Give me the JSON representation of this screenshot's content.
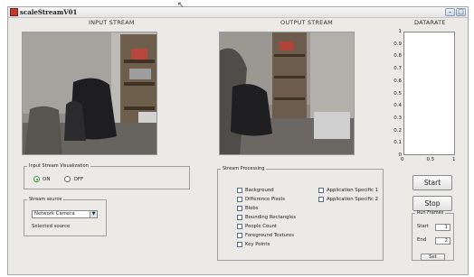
{
  "window": {
    "title": "scaleStreamV01",
    "min_glyph": "–",
    "max_glyph": "□"
  },
  "headings": {
    "input": "INPUT STREAM",
    "output": "OUTPUT STREAM",
    "datarate": "DATARATE"
  },
  "datarate_plot": {
    "y_ticks": [
      "1",
      "0.9",
      "0.8",
      "0.7",
      "0.6",
      "0.5",
      "0.4",
      "0.3",
      "0.2",
      "0.1",
      "0"
    ],
    "x_ticks": [
      "0",
      "0.5",
      "1"
    ]
  },
  "visualization": {
    "legend": "Input Stream Visualization",
    "options": [
      {
        "label": "ON",
        "selected": true
      },
      {
        "label": "OFF",
        "selected": false
      }
    ]
  },
  "source": {
    "legend": "Stream source",
    "selected_value": "Network Camera",
    "status_label": "Selected source"
  },
  "processing": {
    "legend": "Stream Processing",
    "col1": [
      "Background",
      "Difference Pixels",
      "Blobs",
      "Bounding Rectangles",
      "People Count",
      "Foreground Textures",
      "Key Points"
    ],
    "col2": [
      "Application Specific 1",
      "Application Specific 2"
    ]
  },
  "controls": {
    "start_label": "Start",
    "stop_label": "Stop"
  },
  "run_frames": {
    "legend": "Run Frames",
    "start_label": "Start",
    "start_value": "1",
    "end_label": "End",
    "end_value": "2",
    "set_label": "Set"
  },
  "colors": {
    "window_bg": "#eceae6",
    "accent_radio": "#2a8a2a"
  }
}
